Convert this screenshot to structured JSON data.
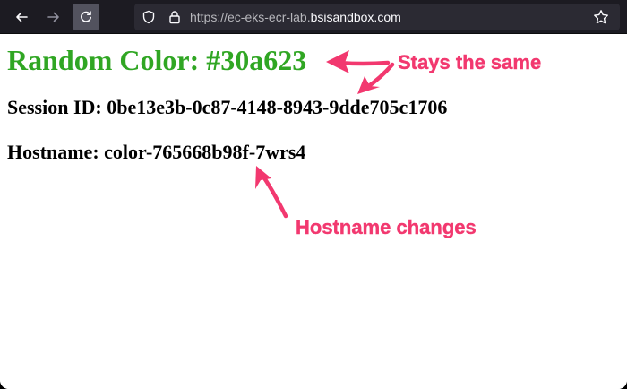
{
  "browser": {
    "url_prefix": "https://ec-eks-ecr-lab.",
    "url_domain": "bsisandbox.com",
    "icons": [
      "back-arrow-icon",
      "forward-arrow-icon",
      "reload-icon",
      "shield-icon",
      "lock-icon",
      "star-icon"
    ]
  },
  "page": {
    "color_heading": "Random Color: #30a623",
    "color_value": "#30a623",
    "session_id": "Session ID: 0be13e3b-0c87-4148-8943-9dde705c1706",
    "hostname": "Hostname: color-765668b98f-7wrs4"
  },
  "annotations": {
    "stays_same": "Stays the same",
    "hostname_changes": "Hostname changes",
    "color": "#f2386f"
  }
}
